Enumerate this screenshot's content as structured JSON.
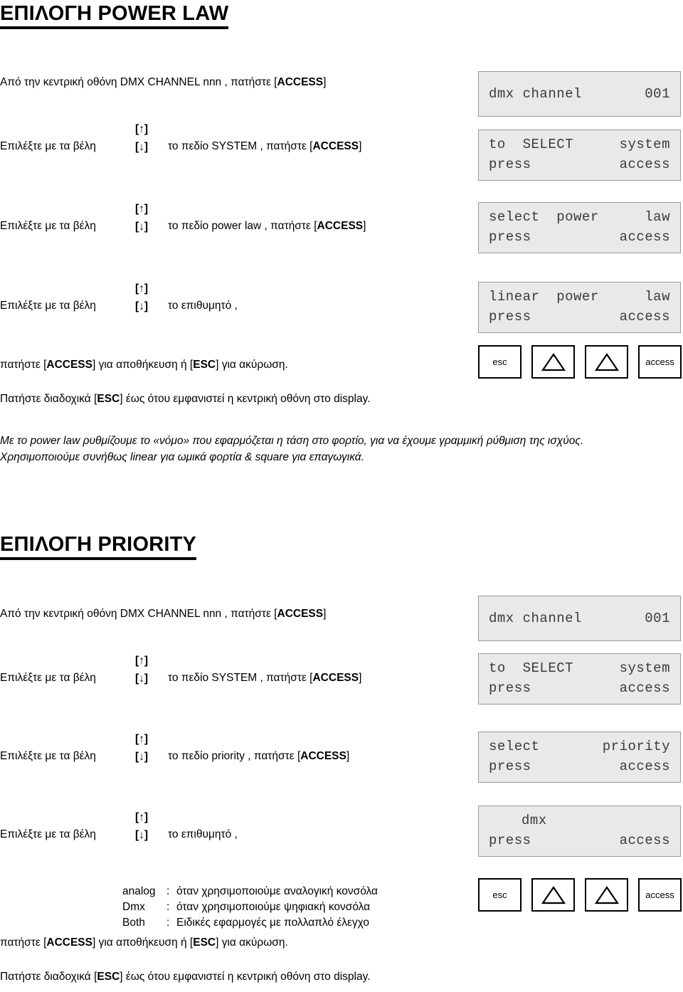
{
  "sections": [
    {
      "title": "ΕΠΙΛΟΓΗ POWER LAW",
      "intro": {
        "pre": "Από την κεντρική οθόνη  DMX CHANNEL nnn , πατήστε [",
        "key": "ACCESS",
        "post": "]"
      },
      "steps": [
        {
          "lead": "Επιλέξτε με τα βέλη",
          "arrow_up": "[↑]",
          "arrow_down": "[↓]",
          "body_pre": "το πεδίο  SYSTEM , πατήστε [",
          "body_key": "ACCESS",
          "body_post": "]"
        },
        {
          "lead": "Επιλέξτε με τα βέλη",
          "arrow_up": "[↑]",
          "arrow_down": "[↓]",
          "body_pre": "το πεδίο  power law , πατήστε [",
          "body_key": "ACCESS",
          "body_post": "]"
        },
        {
          "lead": "Επιλέξτε με τα βέλη",
          "arrow_up": "[↑]",
          "arrow_down": "[↓]",
          "body_pre": "το επιθυμητό ,",
          "body_key": "",
          "body_post": ""
        }
      ],
      "save_line": {
        "a": "πατήστε [",
        "k1": "ACCESS",
        "b": "] για αποθήκευση ή [",
        "k2": "ESC",
        "c": "] για ακύρωση."
      },
      "escape_line": {
        "a": "Πατήστε διαδοχικά [",
        "k1": "ESC",
        "b": "] έως ότου εμφανιστεί η κεντρική οθόνη στο display."
      },
      "note": "Με το power law ρυθμίζουμε το «νόμο» που εφαρμόζεται η τάση στο φορτίο, για να έχουμε γραμμική ρύθμιση της ισχύος. Χρησιμοποιούμε συνήθως linear για ωμικά φορτία & square για επαγωγικά.",
      "displays": [
        {
          "lines": [
            {
              "left": "dmx channel",
              "right": "001"
            }
          ]
        },
        {
          "lines": [
            {
              "left": "to  SELECT",
              "right": "system"
            },
            {
              "left": "press",
              "right": "access"
            }
          ]
        },
        {
          "lines": [
            {
              "left": "select  power",
              "right": "law"
            },
            {
              "left": "press",
              "right": "access"
            }
          ]
        },
        {
          "lines": [
            {
              "left": "linear  power",
              "right": "law"
            },
            {
              "left": "press",
              "right": "access"
            }
          ]
        }
      ]
    },
    {
      "title": "ΕΠΙΛΟΓΗ PRIORITY",
      "intro": {
        "pre": "Από την κεντρική οθόνη  DMX CHANNEL nnn , πατήστε [",
        "key": "ACCESS",
        "post": "]"
      },
      "steps": [
        {
          "lead": "Επιλέξτε με τα βέλη",
          "arrow_up": "[↑]",
          "arrow_down": "[↓]",
          "body_pre": "το πεδίο  SYSTEM , πατήστε [",
          "body_key": "ACCESS",
          "body_post": "]"
        },
        {
          "lead": "Επιλέξτε με τα βέλη",
          "arrow_up": "[↑]",
          "arrow_down": "[↓]",
          "body_pre": "το πεδίο  priority , πατήστε [",
          "body_key": "ACCESS",
          "body_post": "]"
        },
        {
          "lead": "Επιλέξτε με τα βέλη",
          "arrow_up": "[↑]",
          "arrow_down": "[↓]",
          "body_pre": "το επιθυμητό ,",
          "body_key": "",
          "body_post": ""
        }
      ],
      "legend": [
        {
          "key": "analog",
          "sep": ":",
          "desc": "όταν χρησιμοποιούμε αναλογική κονσόλα"
        },
        {
          "key": "Dmx",
          "sep": ":",
          "desc": "όταν χρησιμοποιούμε ψηφιακή κονσόλα"
        },
        {
          "key": "Both",
          "sep": ":",
          "desc": "Ειδικές εφαρμογές με πολλαπλό έλεγχο"
        }
      ],
      "save_line": {
        "a": "πατήστε [",
        "k1": "ACCESS",
        "b": "] για αποθήκευση ή [",
        "k2": "ESC",
        "c": "] για ακύρωση."
      },
      "escape_line": {
        "a": "Πατήστε διαδοχικά [",
        "k1": "ESC",
        "b": "] έως ότου εμφανιστεί η κεντρική οθόνη στο display."
      },
      "displays": [
        {
          "lines": [
            {
              "left": "dmx channel",
              "right": "001"
            }
          ]
        },
        {
          "lines": [
            {
              "left": "to  SELECT",
              "right": "system"
            },
            {
              "left": "press",
              "right": "access"
            }
          ]
        },
        {
          "lines": [
            {
              "left": "select",
              "right": "priority"
            },
            {
              "left": "press",
              "right": "access"
            }
          ]
        },
        {
          "lines": [
            {
              "left": "dmx",
              "right": ""
            },
            {
              "left": "press",
              "right": "access"
            }
          ]
        }
      ]
    }
  ],
  "keypad": {
    "esc_label": "esc",
    "access_label": "access",
    "up_icon": "triangle-up-icon",
    "down_icon": "triangle-up-icon-2"
  },
  "colors": {
    "lcd_background": "#e9e9e9",
    "lcd_border": "#9a9a9a",
    "lcd_text": "#3a3a3a",
    "page_background": "#ffffff",
    "text": "#000000"
  }
}
